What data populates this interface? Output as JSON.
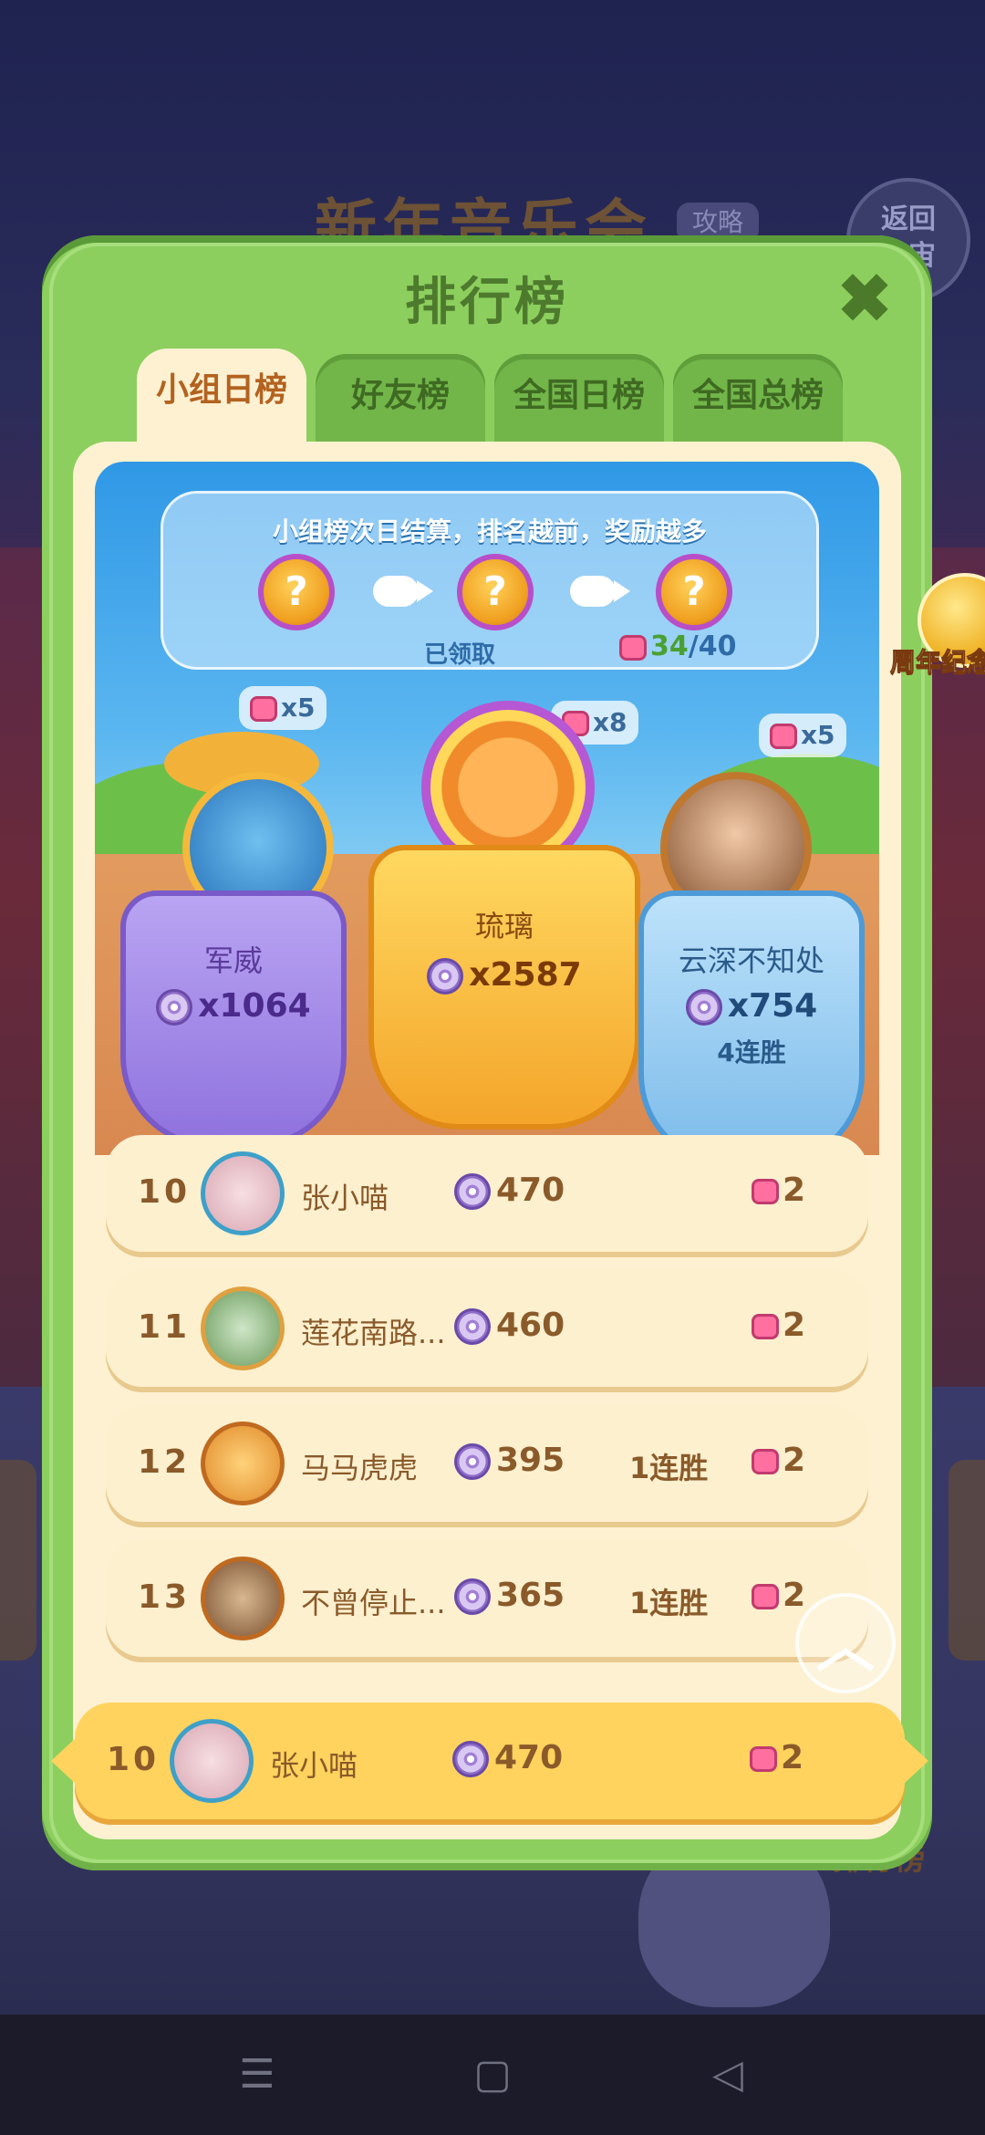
{
  "background": {
    "event_title": "新年音乐会",
    "guide_label": "攻略",
    "back_label": "返回\n宇宙",
    "rank_link": "排行榜"
  },
  "modal": {
    "title": "排行榜",
    "close_icon": "close-icon",
    "tabs": [
      {
        "label": "小组日榜",
        "active": true
      },
      {
        "label": "好友榜",
        "active": false
      },
      {
        "label": "全国日榜",
        "active": false
      },
      {
        "label": "全国总榜",
        "active": false
      }
    ],
    "coin_badge": {
      "label": "周年纪念币"
    }
  },
  "rewards": {
    "caption": "小组榜次日结算，排名越前，奖励越多",
    "claimed_label": "已领取",
    "fragment_current": "34",
    "fragment_total": "/40"
  },
  "podium": {
    "first": {
      "name": "琉璃",
      "score": "x2587",
      "reward": "x8"
    },
    "second": {
      "name": "军威",
      "score": "x1064",
      "reward": "x5"
    },
    "third": {
      "name": "云深不知处",
      "score": "x754",
      "streak": "4连胜",
      "reward": "x5"
    }
  },
  "list": [
    {
      "rank": "10",
      "name": "张小喵",
      "score": "470",
      "streak": "",
      "fragments": "2"
    },
    {
      "rank": "11",
      "name": "莲花南路...",
      "score": "460",
      "streak": "",
      "fragments": "2"
    },
    {
      "rank": "12",
      "name": "马马虎虎",
      "score": "395",
      "streak": "1连胜",
      "fragments": "2"
    },
    {
      "rank": "13",
      "name": "不曾停止...",
      "score": "365",
      "streak": "1连胜",
      "fragments": "2"
    }
  ],
  "my_rank": {
    "rank": "10",
    "name": "张小喵",
    "score": "470",
    "fragments": "2"
  },
  "colors": {
    "modal_green": "#8ccf5e",
    "gold": "#ffd35e",
    "sky": "#5cb7f0",
    "text_brown": "#8a5a2a"
  },
  "navbar": {
    "icons": [
      "menu-icon",
      "home-square-icon",
      "back-triangle-icon"
    ]
  }
}
